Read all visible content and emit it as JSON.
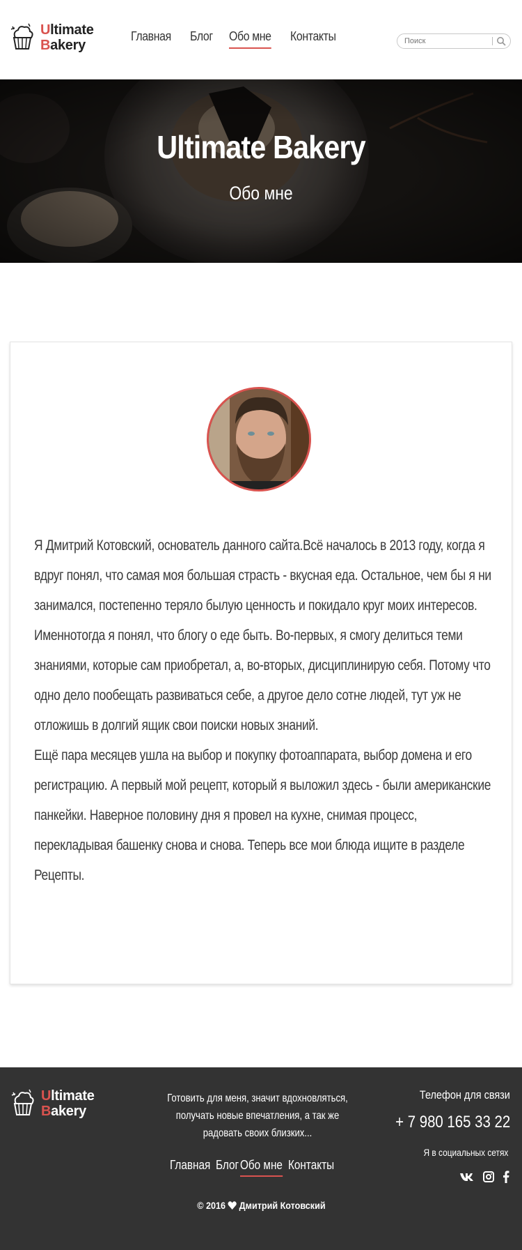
{
  "brand": {
    "first_letter_1": "U",
    "rest_1": "ltimate",
    "first_letter_2": "B",
    "rest_2": "akery"
  },
  "nav": [
    {
      "label": "Главная"
    },
    {
      "label": "Блог"
    },
    {
      "label": "Обо мне"
    },
    {
      "label": "Контакты"
    }
  ],
  "search": {
    "placeholder": "Поиск"
  },
  "hero": {
    "title": "Ultimate Bakery",
    "subtitle": "Обо мне"
  },
  "bio": {
    "paragraph_1": "Я Дмитрий Котовский, основатель данного сайта.Всё началось в 2013 году, когда я вдруг понял, что самая моя большая страсть - вкусная еда. Остальное, чем бы я ни занимался, постепенно теряло былую ценность и покидало круг моих интересов. Именнотогда я понял, что блогу о еде быть. Во-первых, я смогу делиться теми знаниями, которые сам приобретал, а, во-вторых, дисциплинирую себя. Потому что одно дело пообещать развиваться себе, а другое дело сотне людей, тут уж не отложишь в долгий ящик свои поиски новых знаний.",
    "paragraph_2": "Ещё пара месяцев ушла на выбор и покупку фотоаппарата, выбор домена и его регистрацию. А первый мой рецепт, который я выложил здесь - были американские панкейки. Наверное половину дня я провел на кухне, снимая процесс, перекладывая башенку снова и снова. Теперь все мои блюда ищите в разделе Рецепты."
  },
  "footer": {
    "tagline": "Готовить для меня, значит вдохновляться, получать новые впечатления, а так же радовать своих близких...",
    "phone_label": "Телефон для связи",
    "phone": "+ 7 980 165 33 22",
    "social_label": "Я в социальных сетях",
    "copyright_prefix": "© 2016",
    "copyright_name": "Дмитрий Котовский"
  },
  "colors": {
    "accent": "#d9534f",
    "footer_bg": "#333333"
  },
  "icons": [
    "cupcake-logo-icon",
    "search-icon",
    "vk-icon",
    "instagram-icon",
    "facebook-icon",
    "heart-icon"
  ]
}
